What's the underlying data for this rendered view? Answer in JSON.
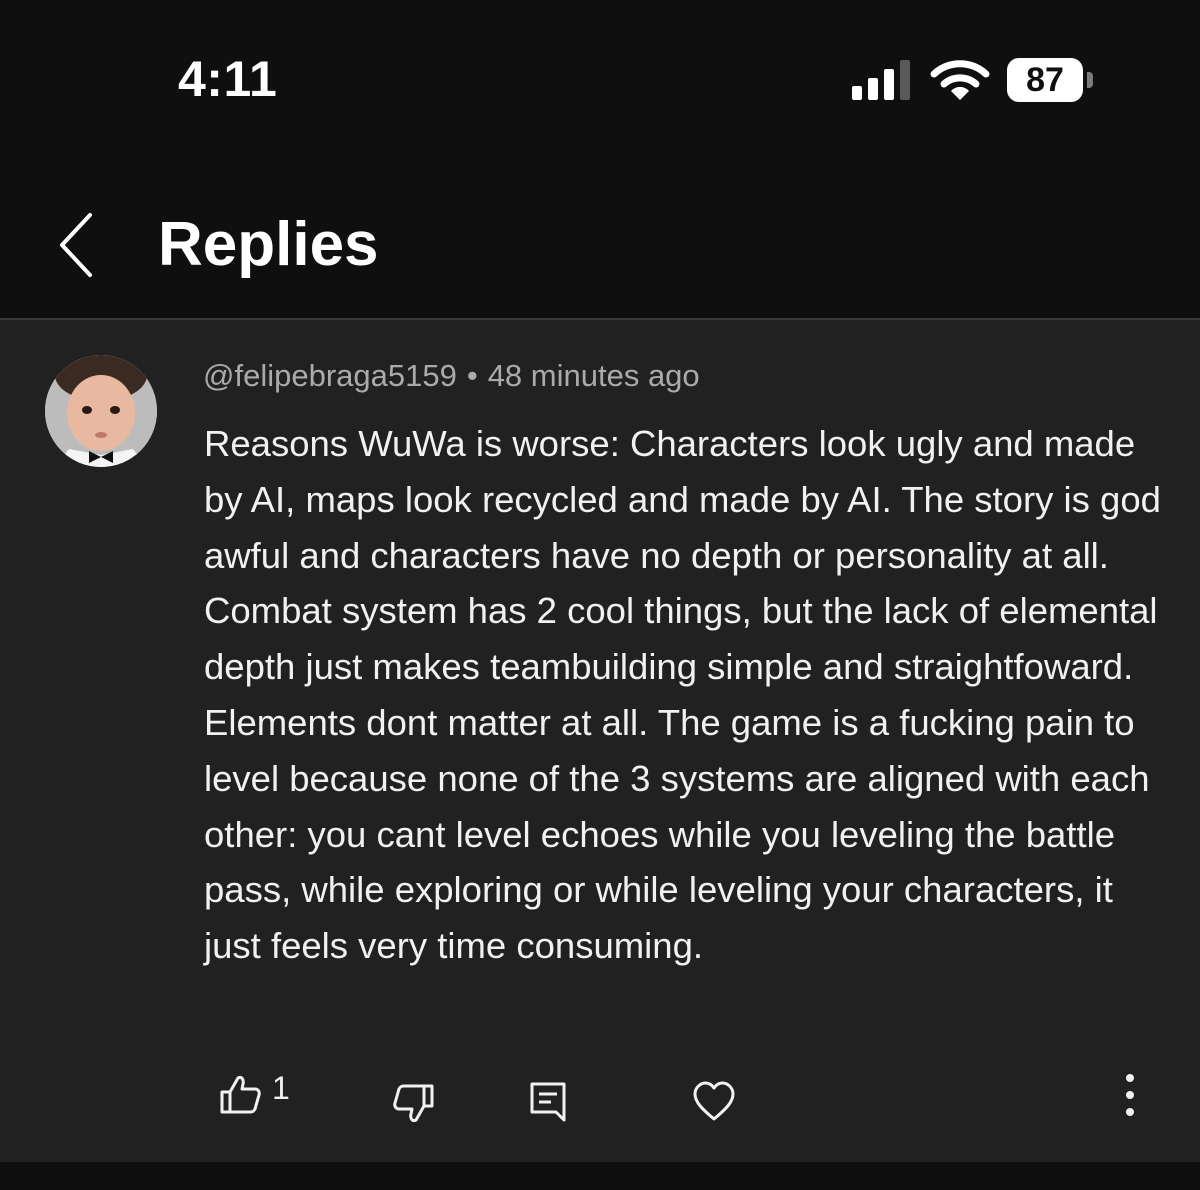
{
  "status_bar": {
    "time": "4:11",
    "battery_level": "87"
  },
  "header": {
    "title": "Replies"
  },
  "comment": {
    "author": "@felipebraga5159",
    "separator": "•",
    "timestamp": "48 minutes ago",
    "text": "Reasons WuWa is worse: Characters look ugly and made by AI, maps look recycled and made by AI. The story is god awful and characters have no depth or personality at all. Combat system has 2 cool things, but the lack of elemental depth just makes teambuilding simple and straightfoward. Elements dont matter at all. The game is a fucking pain to level because none of the 3 systems are aligned with each other: you cant level echoes while you leveling the battle pass, while exploring or while leveling your characters, it just feels very time consuming.",
    "like_count": "1"
  },
  "icons": {
    "back": "chevron-left-icon",
    "like": "thumbs-up-icon",
    "dislike": "thumbs-down-icon",
    "reply": "comment-icon",
    "heart": "heart-icon",
    "more": "more-vertical-icon",
    "signal": "cellular-signal-icon",
    "wifi": "wifi-icon",
    "battery": "battery-icon"
  },
  "colors": {
    "background": "#0f0f0f",
    "comment_background": "#212121",
    "text_primary": "#f1f1f1",
    "text_secondary": "#aaaaaa"
  }
}
